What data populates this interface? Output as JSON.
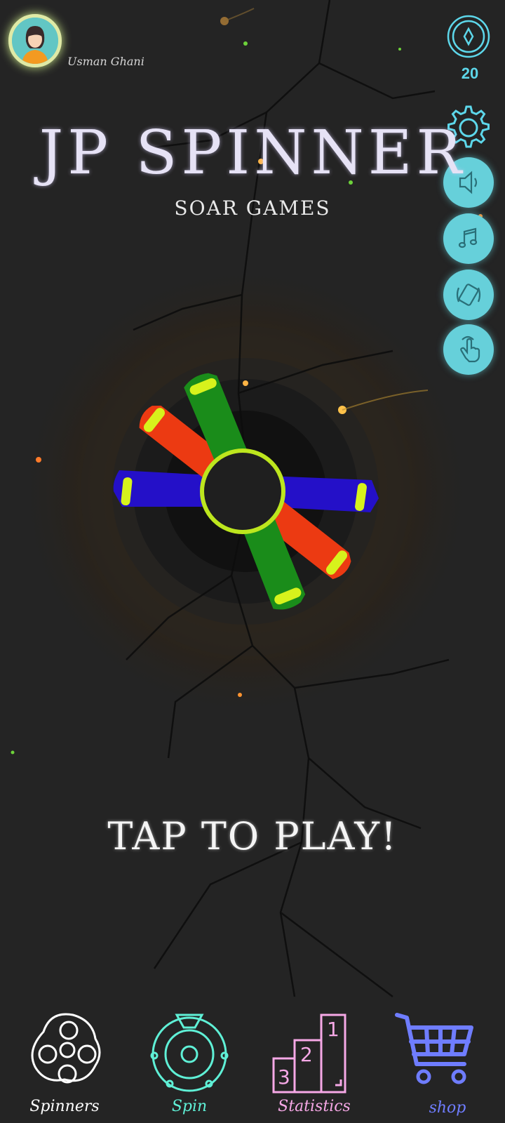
{
  "profile": {
    "username": "Usman Ghani"
  },
  "currency": {
    "icon": "diamond-coin-icon",
    "amount": "20"
  },
  "side_buttons": [
    {
      "name": "settings-button",
      "icon": "gear-icon"
    },
    {
      "name": "sound-button",
      "icon": "speaker-icon"
    },
    {
      "name": "music-button",
      "icon": "music-note-icon"
    },
    {
      "name": "vibration-button",
      "icon": "vibration-icon"
    },
    {
      "name": "touch-button",
      "icon": "hand-pointer-icon"
    }
  ],
  "title": {
    "main": "JP SPINNER",
    "sub": "SOAR GAMES"
  },
  "spinner": {
    "arm_colors": [
      "#1a8c1a",
      "#ec3a12",
      "#2410c8"
    ],
    "hub_color": "#bde61e",
    "cap_color": "#d7f21c"
  },
  "cta": {
    "label": "TAP TO PLAY!"
  },
  "nav": [
    {
      "label": "Spinners",
      "icon": "spinner-icon",
      "color": "#ffffff"
    },
    {
      "label": "Spin",
      "icon": "spin-wheel-icon",
      "color": "#5ff0d6"
    },
    {
      "label": "Statistics",
      "icon": "podium-icon",
      "color": "#f6a8e6"
    },
    {
      "label": "shop",
      "icon": "shopping-cart-icon",
      "color": "#6f7dff"
    }
  ]
}
